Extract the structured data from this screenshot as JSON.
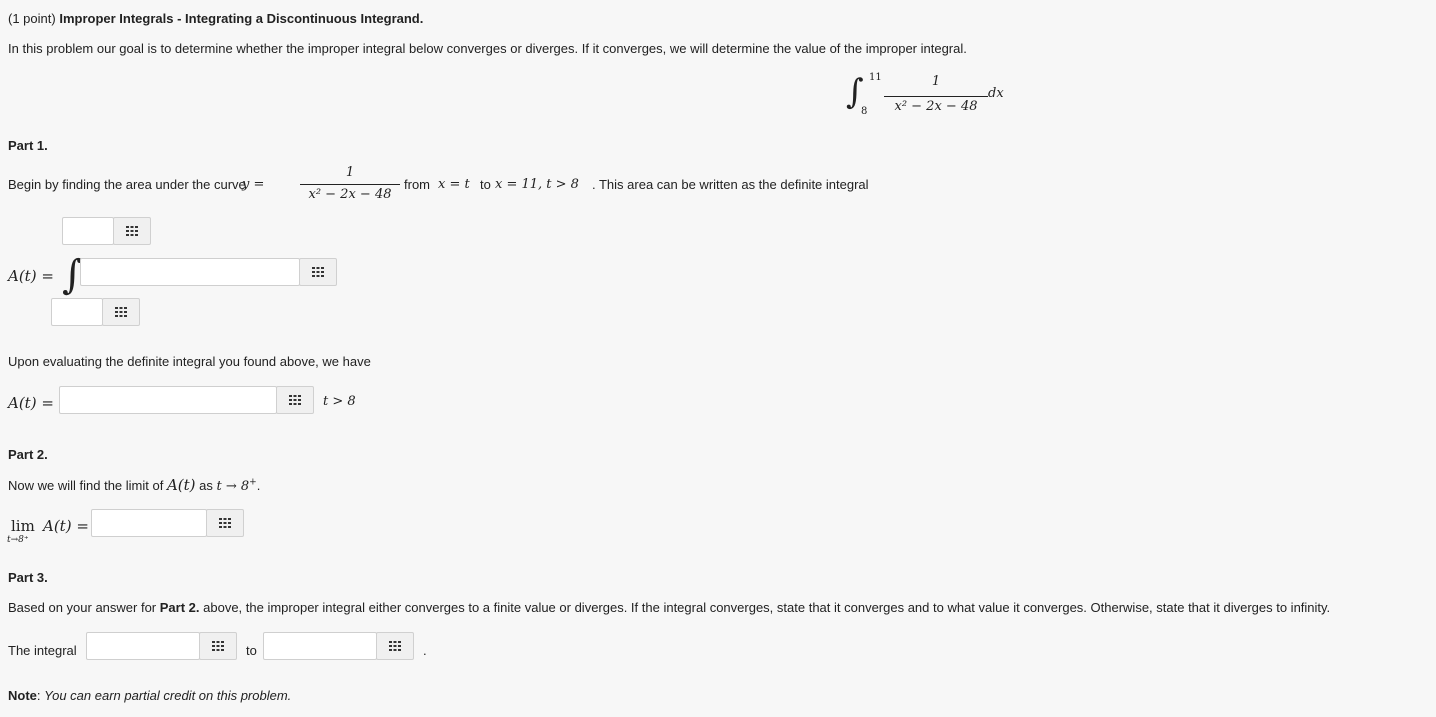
{
  "header": {
    "points": "(1 point)",
    "title": "Improper Integrals - Integrating a Discontinuous Integrand."
  },
  "intro": "In this problem our goal is to determine whether the improper integral below converges or diverges. If it converges, we will determine the value of the improper integral.",
  "display_integral": {
    "upper": "11",
    "lower": "8",
    "numerator": "1",
    "denominator": "x² − 2x − 48",
    "dx": "dx"
  },
  "part1": {
    "heading": "Part 1.",
    "text_before": "Begin by finding the area under the curve",
    "y_eq": "y =",
    "frac_num": "1",
    "frac_den": "x² − 2x − 48",
    "from": "from",
    "x_eq_t": "x = t",
    "to": "to",
    "x_eq_11": "x = 11, t > 8",
    "text_after": ". This area can be written as the definite integral",
    "A_label": "A(t) =",
    "evaluating_text": "Upon evaluating the definite integral you found above, we have",
    "A_label2": "A(t) =",
    "condition": "t > 8"
  },
  "part2": {
    "heading": "Part 2.",
    "text": "Now we will find the limit of",
    "A_t": "A(t)",
    "as": "as",
    "t_arrow": "t → 8",
    "plus_sup": "+",
    "period": ".",
    "lim": "lim",
    "lim_sub": "t→8⁺",
    "lim_A": "A(t) ="
  },
  "part3": {
    "heading": "Part 3.",
    "text_pre": "Based on your answer for",
    "text_bold": "Part 2.",
    "text_post": "above, the improper integral either converges to a finite value or diverges. If the integral converges, state that it converges and to what value it converges. Otherwise, state that it diverges to infinity.",
    "the_integral": "The integral",
    "to": "to",
    "period": "."
  },
  "note": {
    "label": "Note",
    "colon": ":",
    "text": "You can earn partial credit on this problem."
  }
}
